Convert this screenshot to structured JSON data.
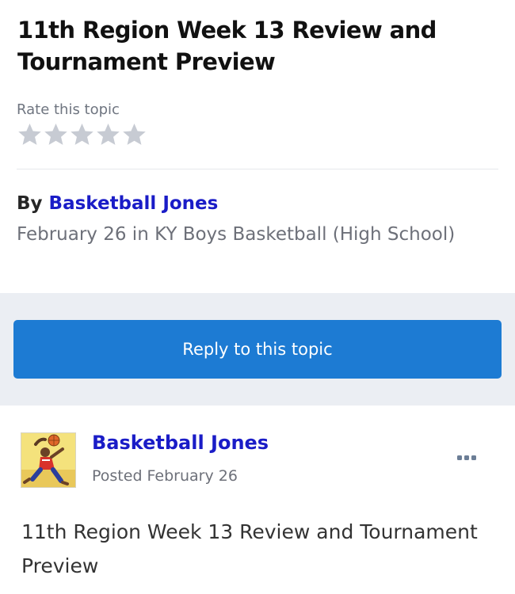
{
  "topic": {
    "title": "11th Region Week 13 Review and Tournament Preview",
    "rate_label": "Rate this topic",
    "rating_filled": 0,
    "rating_max": 5,
    "by_prefix": "By",
    "author": "Basketball Jones",
    "meta": "February 26 in KY Boys Basketball (High School)"
  },
  "actions": {
    "reply_label": "Reply to this topic"
  },
  "post": {
    "author": "Basketball Jones",
    "posted": "Posted February 26",
    "body": "11th Region Week 13 Review and Tournament Preview",
    "avatar_icon": "basketball-player-avatar",
    "menu_icon": "more-dots-icon"
  },
  "colors": {
    "link": "#1a1cc7",
    "button": "#1d7bd3",
    "band": "#ebeef3",
    "star": "#c7cbd3"
  }
}
